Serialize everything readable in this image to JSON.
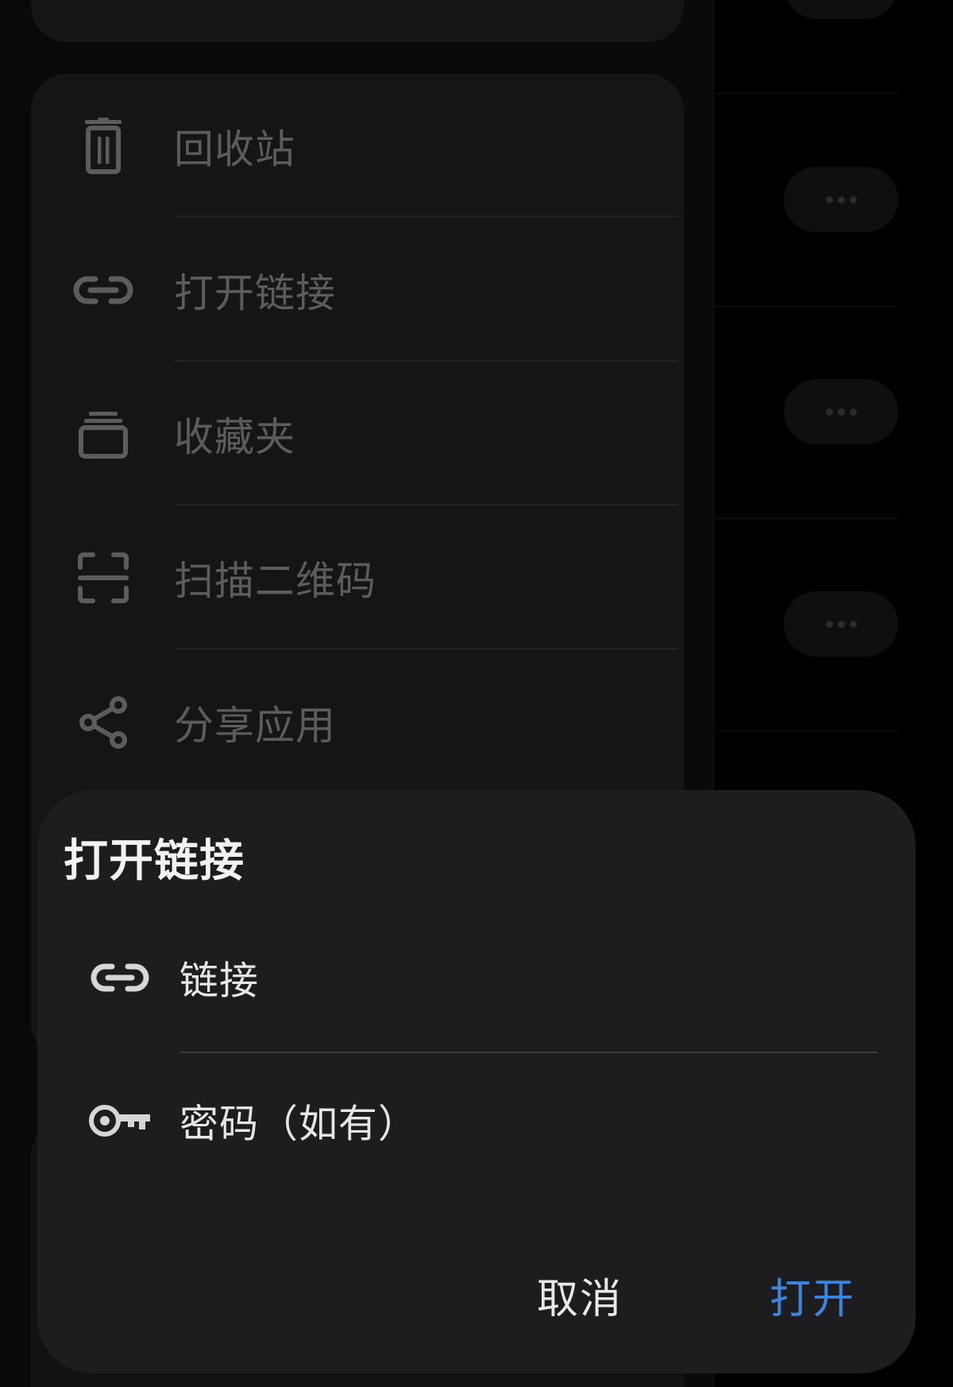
{
  "background": {
    "menu": {
      "items": [
        {
          "label": "回收站",
          "icon": "trash-icon"
        },
        {
          "label": "打开链接",
          "icon": "link-icon"
        },
        {
          "label": "收藏夹",
          "icon": "folder-icon"
        },
        {
          "label": "扫描二维码",
          "icon": "scan-qr-icon"
        },
        {
          "label": "分享应用",
          "icon": "share-icon"
        }
      ]
    },
    "right_list": {
      "more_icon": "more-dots-icon"
    }
  },
  "dialog": {
    "title": "打开链接",
    "fields": {
      "link": {
        "label": "链接",
        "icon": "link-icon"
      },
      "password": {
        "label": "密码（如有）",
        "icon": "key-icon"
      }
    },
    "buttons": {
      "cancel": "取消",
      "open": "打开"
    }
  },
  "colors": {
    "accent": "#3a86e0",
    "dialog_background": "#1d1d20",
    "screen_background": "#000000"
  }
}
